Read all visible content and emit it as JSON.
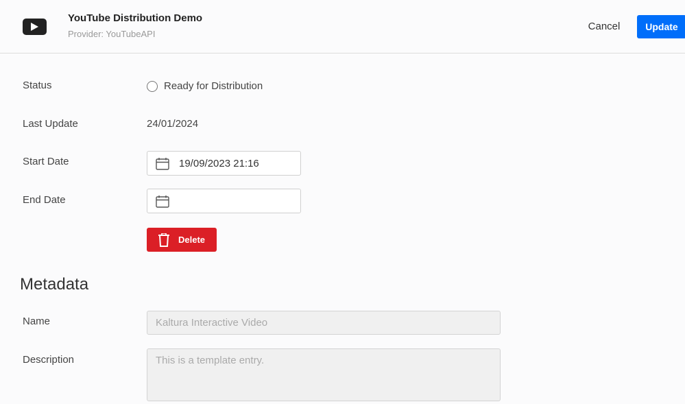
{
  "header": {
    "title": "YouTube Distribution Demo",
    "provider": "Provider: YouTubeAPI",
    "cancel_label": "Cancel",
    "update_label": "Update",
    "accent_color": "#006efa",
    "logo_icon": "youtube-play-icon"
  },
  "distribution": {
    "status_label": "Status",
    "status_value": "Ready for Distribution",
    "last_update_label": "Last Update",
    "last_update_value": "24/01/2024",
    "start_date_label": "Start Date",
    "start_date_value": "19/09/2023 21:16",
    "end_date_label": "End Date",
    "end_date_value": "",
    "delete_label": "Delete",
    "delete_color": "#db1f26"
  },
  "metadata": {
    "section_title": "Metadata",
    "name_label": "Name",
    "name_value": "Kaltura Interactive Video",
    "description_label": "Description",
    "description_value": "This is a template entry."
  }
}
